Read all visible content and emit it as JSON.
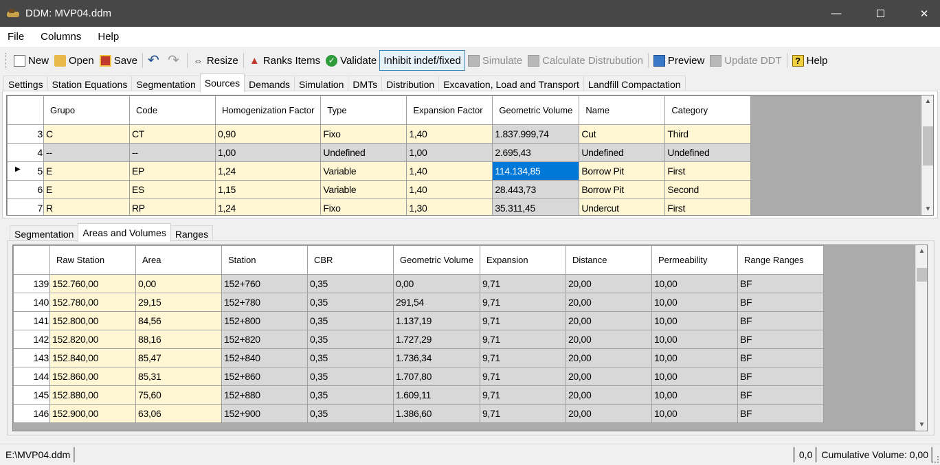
{
  "window": {
    "title": "DDM: MVP04.ddm"
  },
  "menu": [
    "File",
    "Columns",
    "Help"
  ],
  "toolbar": {
    "new": "New",
    "open": "Open",
    "save": "Save",
    "resize": "Resize",
    "ranks": "Ranks Items",
    "validate": "Validate",
    "inhibit": "Inhibit indef/fixed",
    "simulate": "Simulate",
    "calculate": "Calculate Distrubution",
    "preview": "Preview",
    "update": "Update DDT",
    "help": "Help"
  },
  "main_tabs": [
    "Settings",
    "Station Equations",
    "Segmentation",
    "Sources",
    "Demands",
    "Simulation",
    "DMTs",
    "Distribution",
    "Excavation, Load and Transport",
    "Landfill Compactation"
  ],
  "main_tab_active": "Sources",
  "sources_grid": {
    "columns": [
      "Grupo",
      "Code",
      "Homogenization Factor",
      "Type",
      "Expansion Factor",
      "Geometric Volume",
      "Name",
      "Category"
    ],
    "rows": [
      {
        "n": "3",
        "cells": [
          "C",
          "CT",
          "0,90",
          "Fixo",
          "1,40",
          "1.837.999,74",
          "Cut",
          "Third"
        ]
      },
      {
        "n": "4",
        "cells": [
          "--",
          "--",
          "1,00",
          "Undefined",
          "1,00",
          "2.695,43",
          "Undefined",
          "Undefined"
        ]
      },
      {
        "n": "5",
        "cells": [
          "E",
          "EP",
          "1,24",
          "Variable",
          "1,40",
          "114.134,85",
          "Borrow Pit",
          "First"
        ]
      },
      {
        "n": "6",
        "cells": [
          "E",
          "ES",
          "1,15",
          "Variable",
          "1,40",
          "28.443,73",
          "Borrow Pit",
          "Second"
        ]
      },
      {
        "n": "7",
        "cells": [
          "R",
          "RP",
          "1,24",
          "Fixo",
          "1,30",
          "35.311,45",
          "Undercut",
          "First"
        ]
      }
    ]
  },
  "sub_tabs": [
    "Segmentation",
    "Areas and Volumes",
    "Ranges"
  ],
  "sub_tab_active": "Areas and Volumes",
  "areas_grid": {
    "columns": [
      "Raw Station",
      "Area",
      "Station",
      "CBR",
      "Geometric Volume",
      "Expansion",
      "Distance",
      "Permeability",
      "Range Ranges"
    ],
    "rows": [
      {
        "n": "139",
        "cells": [
          "152.760,00",
          "0,00",
          "152+760",
          "0,35",
          "0,00",
          "9,71",
          "20,00",
          "10,00",
          "BF"
        ]
      },
      {
        "n": "140",
        "cells": [
          "152.780,00",
          "29,15",
          "152+780",
          "0,35",
          "291,54",
          "9,71",
          "20,00",
          "10,00",
          "BF"
        ]
      },
      {
        "n": "141",
        "cells": [
          "152.800,00",
          "84,56",
          "152+800",
          "0,35",
          "1.137,19",
          "9,71",
          "20,00",
          "10,00",
          "BF"
        ]
      },
      {
        "n": "142",
        "cells": [
          "152.820,00",
          "88,16",
          "152+820",
          "0,35",
          "1.727,29",
          "9,71",
          "20,00",
          "10,00",
          "BF"
        ]
      },
      {
        "n": "143",
        "cells": [
          "152.840,00",
          "85,47",
          "152+840",
          "0,35",
          "1.736,34",
          "9,71",
          "20,00",
          "10,00",
          "BF"
        ]
      },
      {
        "n": "144",
        "cells": [
          "152.860,00",
          "85,31",
          "152+860",
          "0,35",
          "1.707,80",
          "9,71",
          "20,00",
          "10,00",
          "BF"
        ]
      },
      {
        "n": "145",
        "cells": [
          "152.880,00",
          "75,60",
          "152+880",
          "0,35",
          "1.609,11",
          "9,71",
          "20,00",
          "10,00",
          "BF"
        ]
      },
      {
        "n": "146",
        "cells": [
          "152.900,00",
          "63,06",
          "152+900",
          "0,35",
          "1.386,60",
          "9,71",
          "20,00",
          "10,00",
          "BF"
        ]
      }
    ]
  },
  "status": {
    "path": "E:\\MVP04.ddm",
    "value": "0,0",
    "cumulative": "Cumulative Volume: 0,00"
  }
}
